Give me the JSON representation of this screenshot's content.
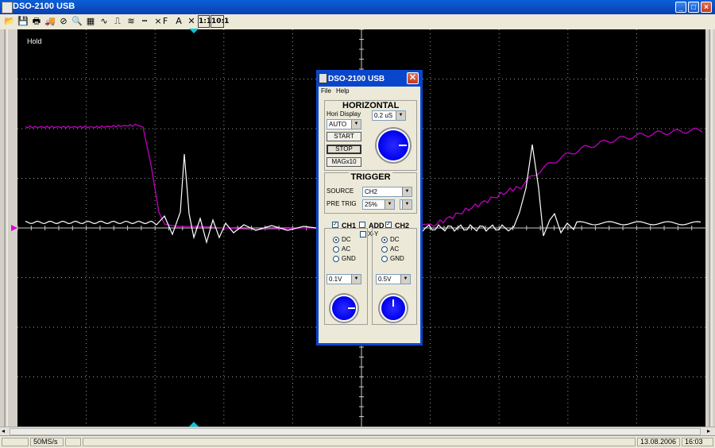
{
  "window": {
    "title": "DSO-2100 USB",
    "minimize": "_",
    "maximize": "□",
    "close": "×"
  },
  "toolbar": {
    "tools": [
      {
        "name": "open-icon",
        "glyph": "📂"
      },
      {
        "name": "save-icon",
        "glyph": "💾"
      },
      {
        "name": "print-icon",
        "glyph": "🖶"
      },
      {
        "name": "truck-icon",
        "glyph": "🚚"
      },
      {
        "name": "stop-icon",
        "glyph": "⊘"
      },
      {
        "name": "zoom-icon",
        "glyph": "🔍"
      },
      {
        "name": "grid-icon",
        "glyph": "▦"
      },
      {
        "name": "sine-icon",
        "glyph": "∿"
      },
      {
        "name": "pulse-icon",
        "glyph": "⎍"
      },
      {
        "name": "waveform-icon",
        "glyph": "≋"
      },
      {
        "name": "dashes-icon",
        "glyph": "┅"
      },
      {
        "name": "cross-icon",
        "glyph": "×"
      },
      {
        "name": "fft-icon",
        "glyph": "F"
      },
      {
        "name": "math-icon",
        "glyph": "A"
      },
      {
        "name": "cursor-icon",
        "glyph": "✕"
      }
    ],
    "ratio1": "1:1",
    "ratio10": "10:1"
  },
  "scope": {
    "hold_label": "Hold",
    "ch1_color": "#ffffff",
    "ch2_color": "#c000c0"
  },
  "statusbar": {
    "sample_rate": "50MS/s",
    "date": "13.08.2006",
    "time": "16:03"
  },
  "dialog": {
    "title": "DSO-2100 USB",
    "menu": {
      "file": "File",
      "help": "Help"
    },
    "horizontal": {
      "header": "HORIZONTAL",
      "hori_display_label": "Hori Display",
      "mode": "AUTO",
      "timebase": "0.2 uS",
      "start": "START",
      "stop": "STOP",
      "mag": "MAGx10"
    },
    "trigger": {
      "header": "TRIGGER",
      "source_label": "SOURCE",
      "source": "CH2",
      "pretrig_label": "PRE TRIG",
      "pretrig": "25%",
      "slope": "-"
    },
    "channels": {
      "ch1_label": "CH1",
      "add_label": "ADD",
      "ch2_label": "CH2",
      "xy_label": "X-Y",
      "coupling_dc": "DC",
      "coupling_ac": "AC",
      "coupling_gnd": "GND",
      "ch1_volts": "0.1V",
      "ch2_volts": "0.5V",
      "checkmark": "✓"
    }
  }
}
